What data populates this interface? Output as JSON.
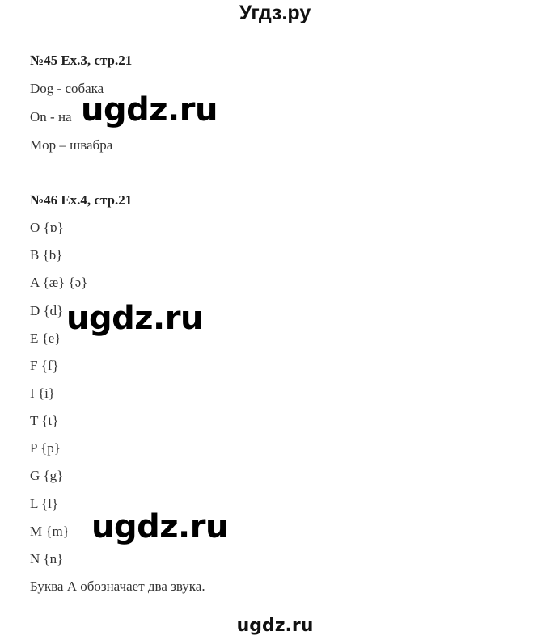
{
  "site_title": "Угдз.ру",
  "exercises": [
    {
      "heading": "№45 Ex.3, стр.21",
      "lines": [
        "Dog - собака",
        "On - на",
        "Mop – швабра"
      ]
    },
    {
      "heading": "№46 Ex.4, стр.21",
      "lines": [
        "O {ɒ}",
        "B {b}",
        "A {æ} {ə}",
        "D {d}",
        "E {e}",
        "F {f}",
        "I {i}",
        "T {t}",
        "P {p}",
        "G {g}",
        "L {l}",
        "M {m}",
        "N {n}",
        "Буква А обозначает два звука."
      ]
    }
  ],
  "watermarks": [
    "ugdz.ru",
    "ugdz.ru",
    "ugdz.ru"
  ],
  "footer_watermark": "ugdz.ru"
}
